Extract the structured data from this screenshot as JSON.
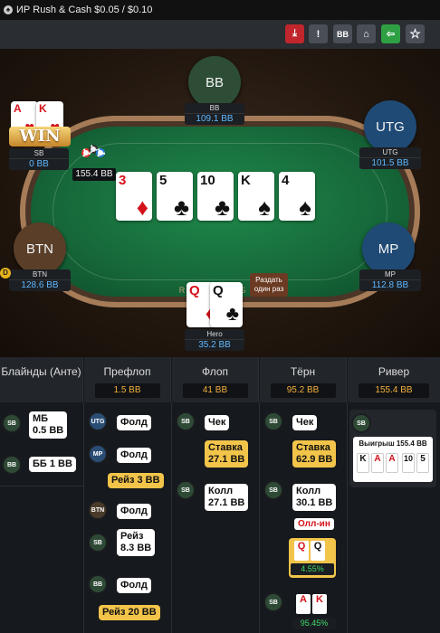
{
  "window": {
    "title": "ИР  Rush & Cash $0.05 / $0.10"
  },
  "toolbar": {
    "download": "⤓",
    "report": "!",
    "bb": "BB",
    "spy": "⌂",
    "share": "⇦",
    "star": "☆"
  },
  "table": {
    "seats": {
      "bb": {
        "avatar": "BB",
        "name": "BB",
        "stack": "109.1 BB"
      },
      "sb": {
        "name": "SB",
        "stack": "0 BB",
        "win": "WIN",
        "cards": [
          {
            "rank": "A",
            "suit": "♥"
          },
          {
            "rank": "K",
            "suit": "♥"
          }
        ]
      },
      "utg": {
        "avatar": "UTG",
        "name": "UTG",
        "stack": "101.5 BB"
      },
      "btn": {
        "avatar": "BTN",
        "name": "BTN",
        "stack": "128.6 BB"
      },
      "mp": {
        "avatar": "MP",
        "name": "MP",
        "stack": "112.8 BB"
      },
      "hero": {
        "name": "Hero",
        "stack": "35.2 BB",
        "cards": [
          {
            "rank": "Q",
            "suit": "♦"
          },
          {
            "rank": "Q",
            "suit": "♣"
          }
        ]
      }
    },
    "pot": "155.4 BB",
    "board": [
      {
        "rank": "3",
        "suit": "♦"
      },
      {
        "rank": "5",
        "suit": "♣"
      },
      {
        "rank": "10",
        "suit": "♣"
      },
      {
        "rank": "K",
        "suit": "♠"
      },
      {
        "rank": "4",
        "suit": "♠"
      }
    ],
    "deal_button": "Раздать\nодин раз",
    "dealer_marker": "D",
    "rail_text": "R U S H     S H"
  },
  "history": {
    "columns": [
      {
        "title": "Блайнды (Анте)",
        "pot": ""
      },
      {
        "title": "Префлоп",
        "pot": "1.5 BB"
      },
      {
        "title": "Флоп",
        "pot": "41 BB"
      },
      {
        "title": "Тёрн",
        "pot": "95.2 BB"
      },
      {
        "title": "Ривер",
        "pot": "155.4 BB"
      }
    ],
    "blinds": [
      {
        "pos": "SB",
        "text": "МБ\n0.5 BB"
      },
      {
        "pos": "BB",
        "text": "ББ 1 BB"
      }
    ],
    "preflop": [
      {
        "pos": "UTG",
        "text": "Фолд"
      },
      {
        "pos": "MP",
        "text": "Фолд"
      },
      {
        "pos": "",
        "text": "Рейз 3 BB"
      },
      {
        "pos": "BTN",
        "text": "Фолд"
      },
      {
        "pos": "SB",
        "text": "Рейз\n8.3 BB"
      },
      {
        "pos": "BB",
        "text": "Фолд"
      },
      {
        "pos": "",
        "text": "Рейз 20 BB"
      }
    ],
    "flop": [
      {
        "pos": "SB",
        "text": "Чек"
      },
      {
        "pos": "",
        "text": "Ставка\n27.1 BB"
      },
      {
        "pos": "SB",
        "text": "Колл\n27.1 BB"
      }
    ],
    "turn": [
      {
        "pos": "SB",
        "text": "Чек"
      },
      {
        "pos": "",
        "text": "Ставка\n62.9 BB"
      },
      {
        "pos": "SB",
        "text": "Колл\n30.1 BB"
      },
      {
        "pos": "",
        "text": "Олл-ин"
      },
      {
        "pos": "",
        "text": "4.55%"
      },
      {
        "pos": "SB",
        "text": "95.45%"
      }
    ],
    "river": {
      "pos": "SB",
      "win": "Выигрыш 155.4 BB",
      "cards": [
        "K",
        "A",
        "A",
        "10",
        "5"
      ]
    }
  },
  "colors": {
    "accent_yellow": "#f2c44a",
    "stack_blue": "#5fb8ff",
    "felt": "#1f8a4a",
    "red_btn": "#c0262c",
    "green_btn": "#2ea043"
  }
}
